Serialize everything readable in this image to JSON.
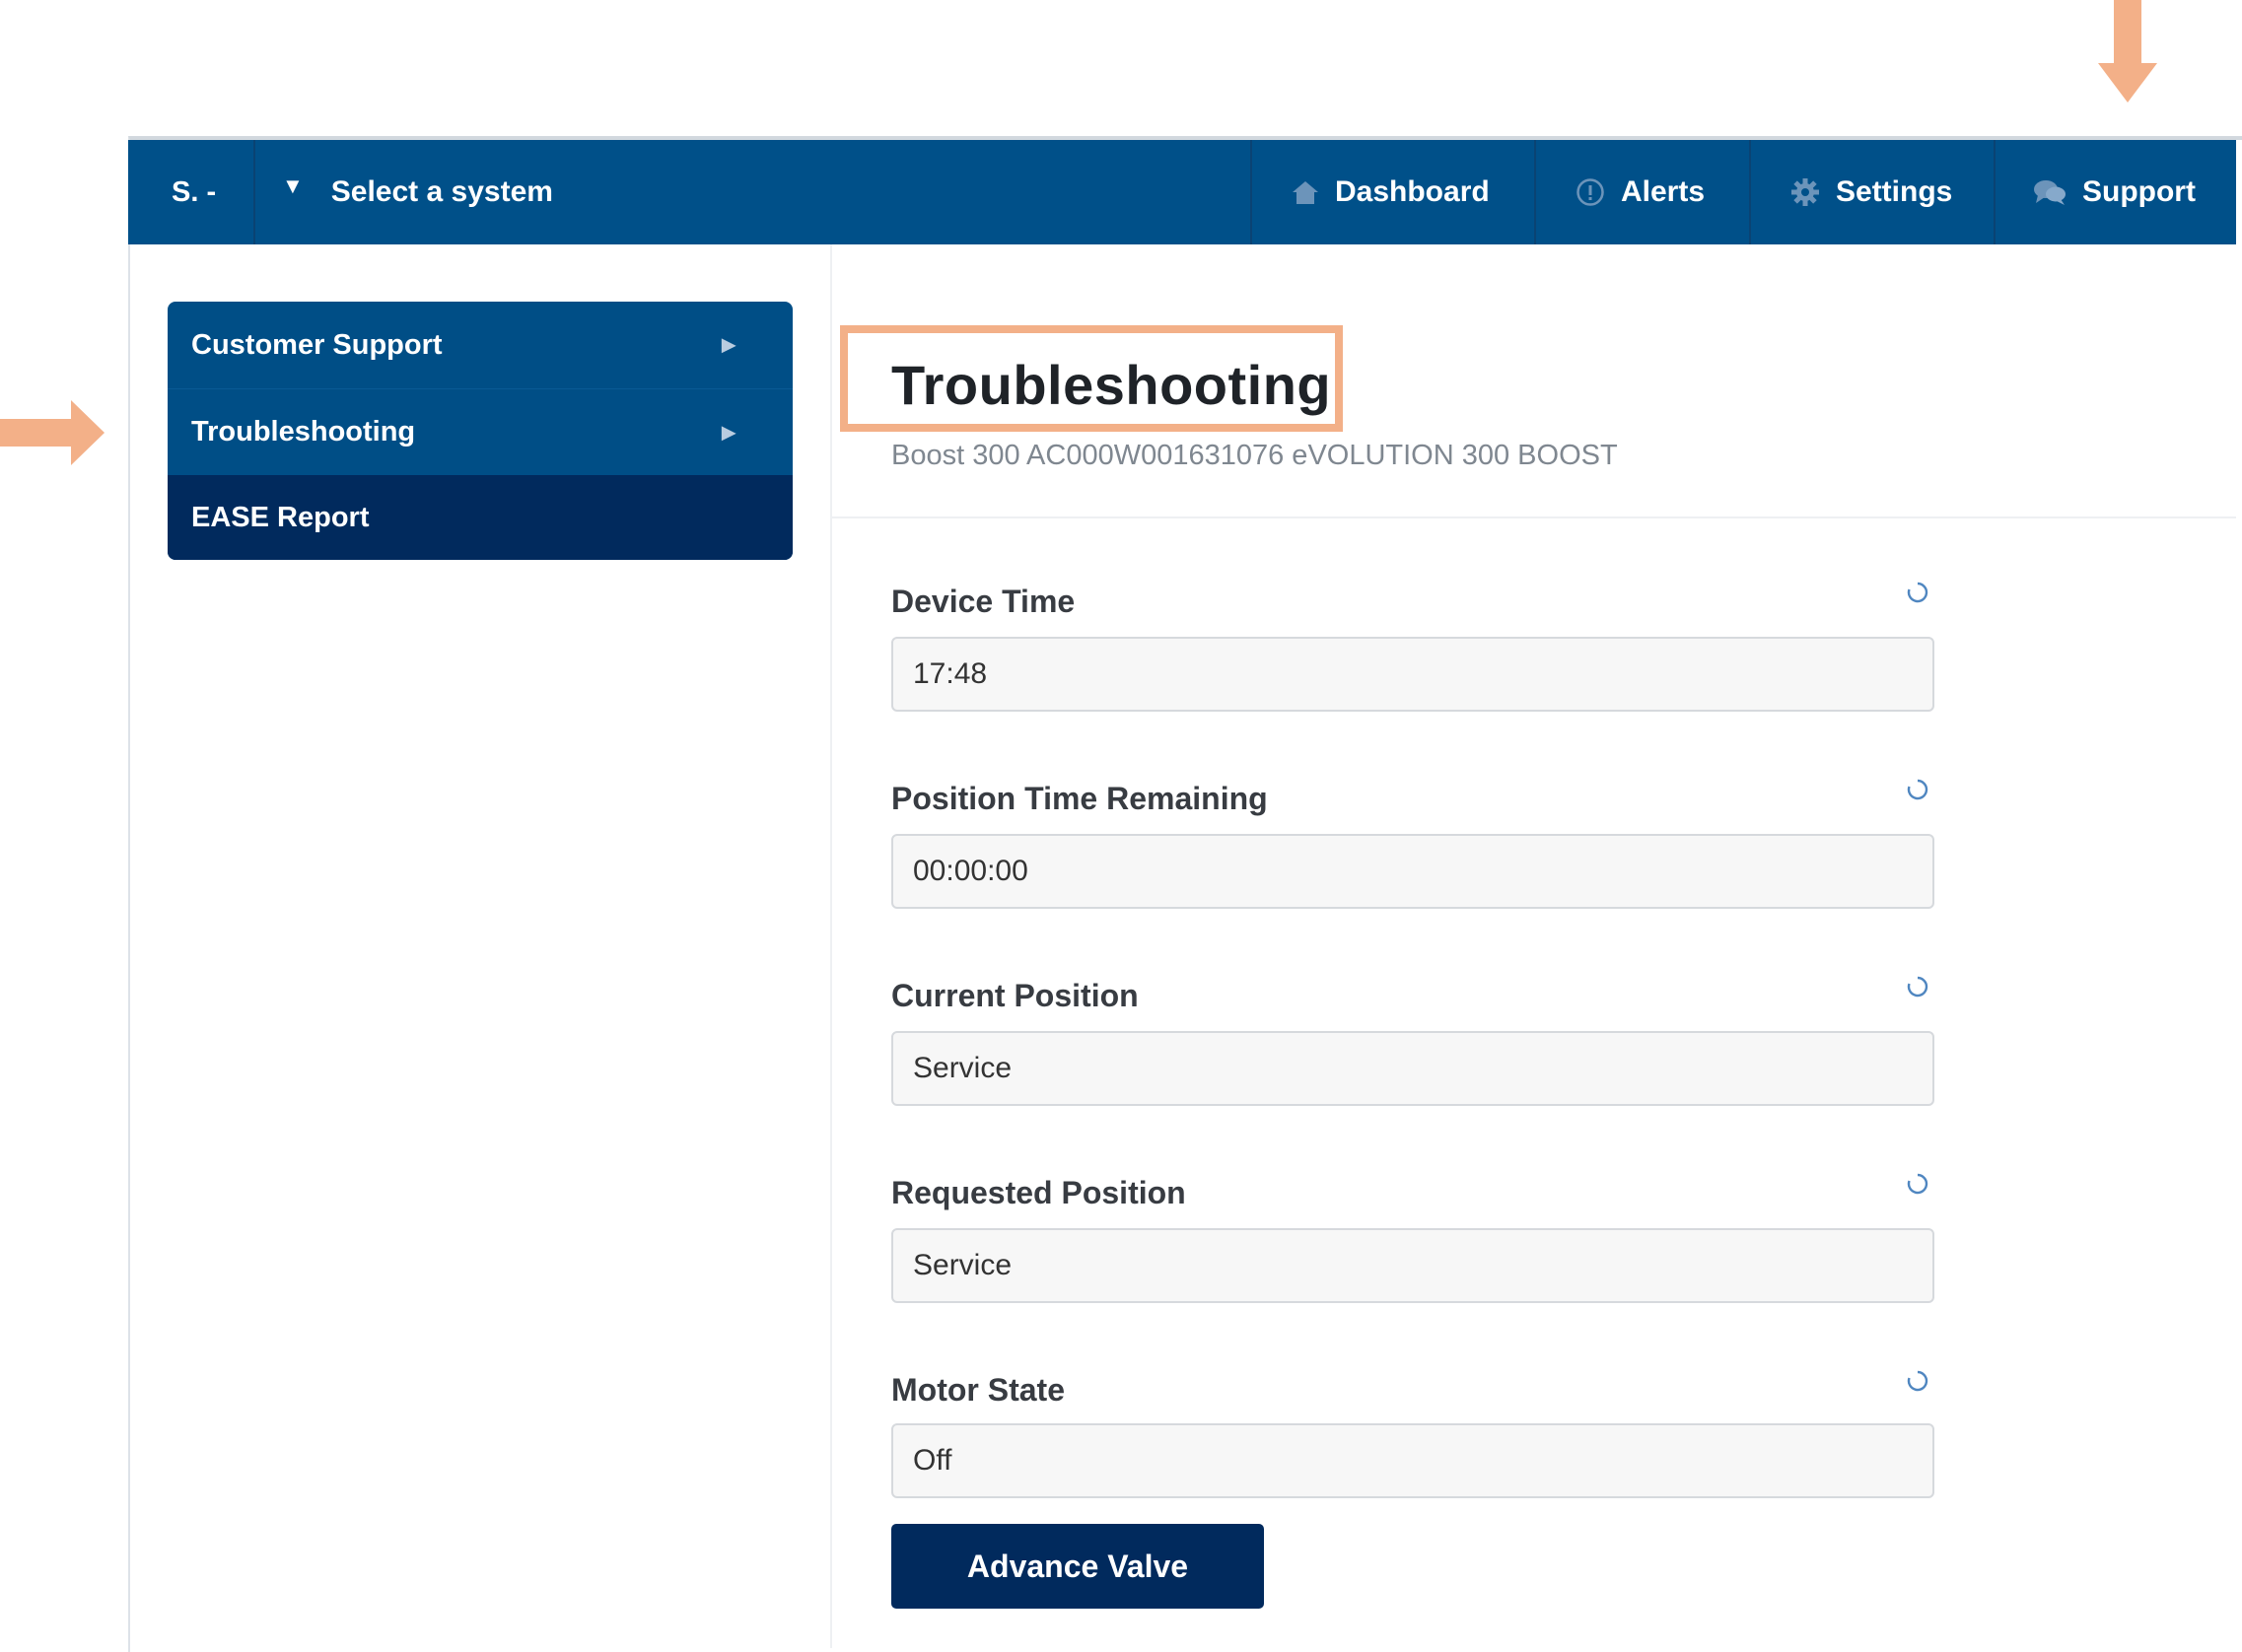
{
  "topbar": {
    "brand": "S. -",
    "system_selector": "Select a system",
    "nav": {
      "dashboard": "Dashboard",
      "alerts": "Alerts",
      "settings": "Settings",
      "support": "Support"
    }
  },
  "sidebar": {
    "items": [
      {
        "label": "Customer Support"
      },
      {
        "label": "Troubleshooting"
      },
      {
        "label": "EASE Report"
      }
    ]
  },
  "page": {
    "title": "Troubleshooting",
    "subtitle": "Boost 300 AC000W001631076 eVOLUTION 300 BOOST"
  },
  "fields": [
    {
      "label": "Device Time",
      "value": "17:48"
    },
    {
      "label": "Position Time Remaining",
      "value": "00:00:00"
    },
    {
      "label": "Current Position",
      "value": "Service"
    },
    {
      "label": "Requested Position",
      "value": "Service"
    },
    {
      "label": "Motor State",
      "value": "Off"
    }
  ],
  "actions": {
    "advance_valve": "Advance Valve"
  },
  "colors": {
    "nav_bg": "#005089",
    "sidebar_active": "#012a5d",
    "annotation": "#f3b088",
    "button_bg": "#012a5d"
  }
}
